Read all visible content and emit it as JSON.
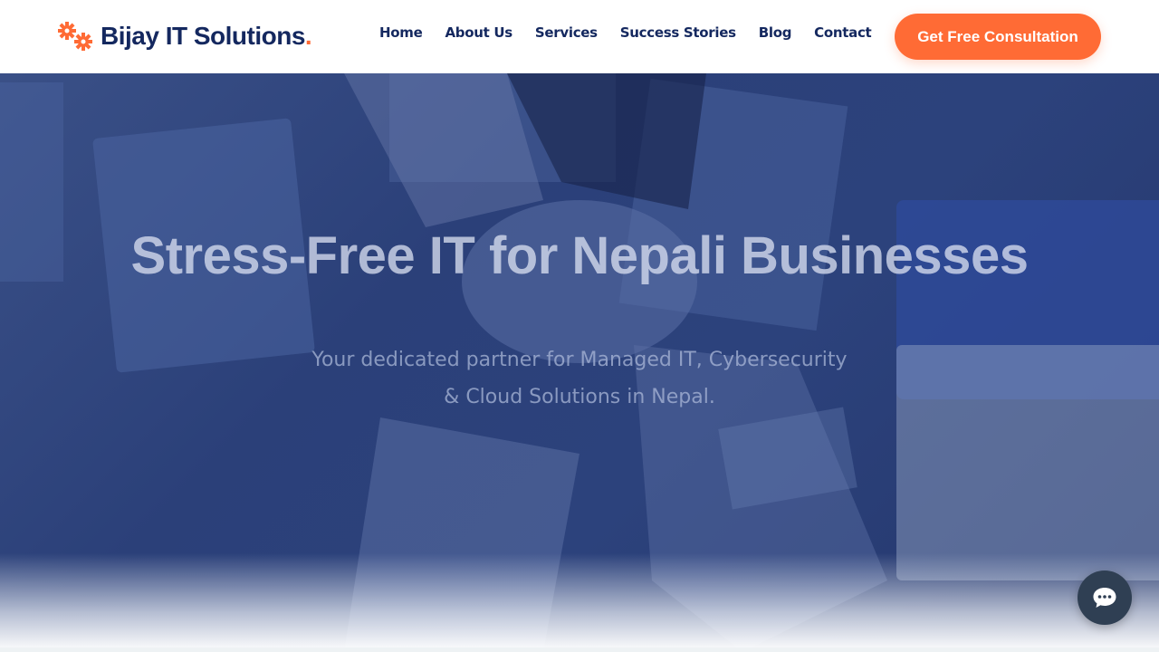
{
  "brand": {
    "name": "Bijay IT Solutions",
    "dot": ".",
    "accent_color": "#ff6b35",
    "primary_color": "#14285f"
  },
  "nav": {
    "items": [
      "Home",
      "About Us",
      "Services",
      "Success Stories",
      "Blog",
      "Contact"
    ]
  },
  "cta": {
    "label": "Get Free Consultation"
  },
  "hero": {
    "title": "Stress-Free IT for Nepali Businesses",
    "subtitle": "Your dedicated partner for Managed IT, Cybersecurity & Cloud Solutions in Nepal."
  },
  "chat": {
    "icon": "chat-bubble-icon"
  }
}
